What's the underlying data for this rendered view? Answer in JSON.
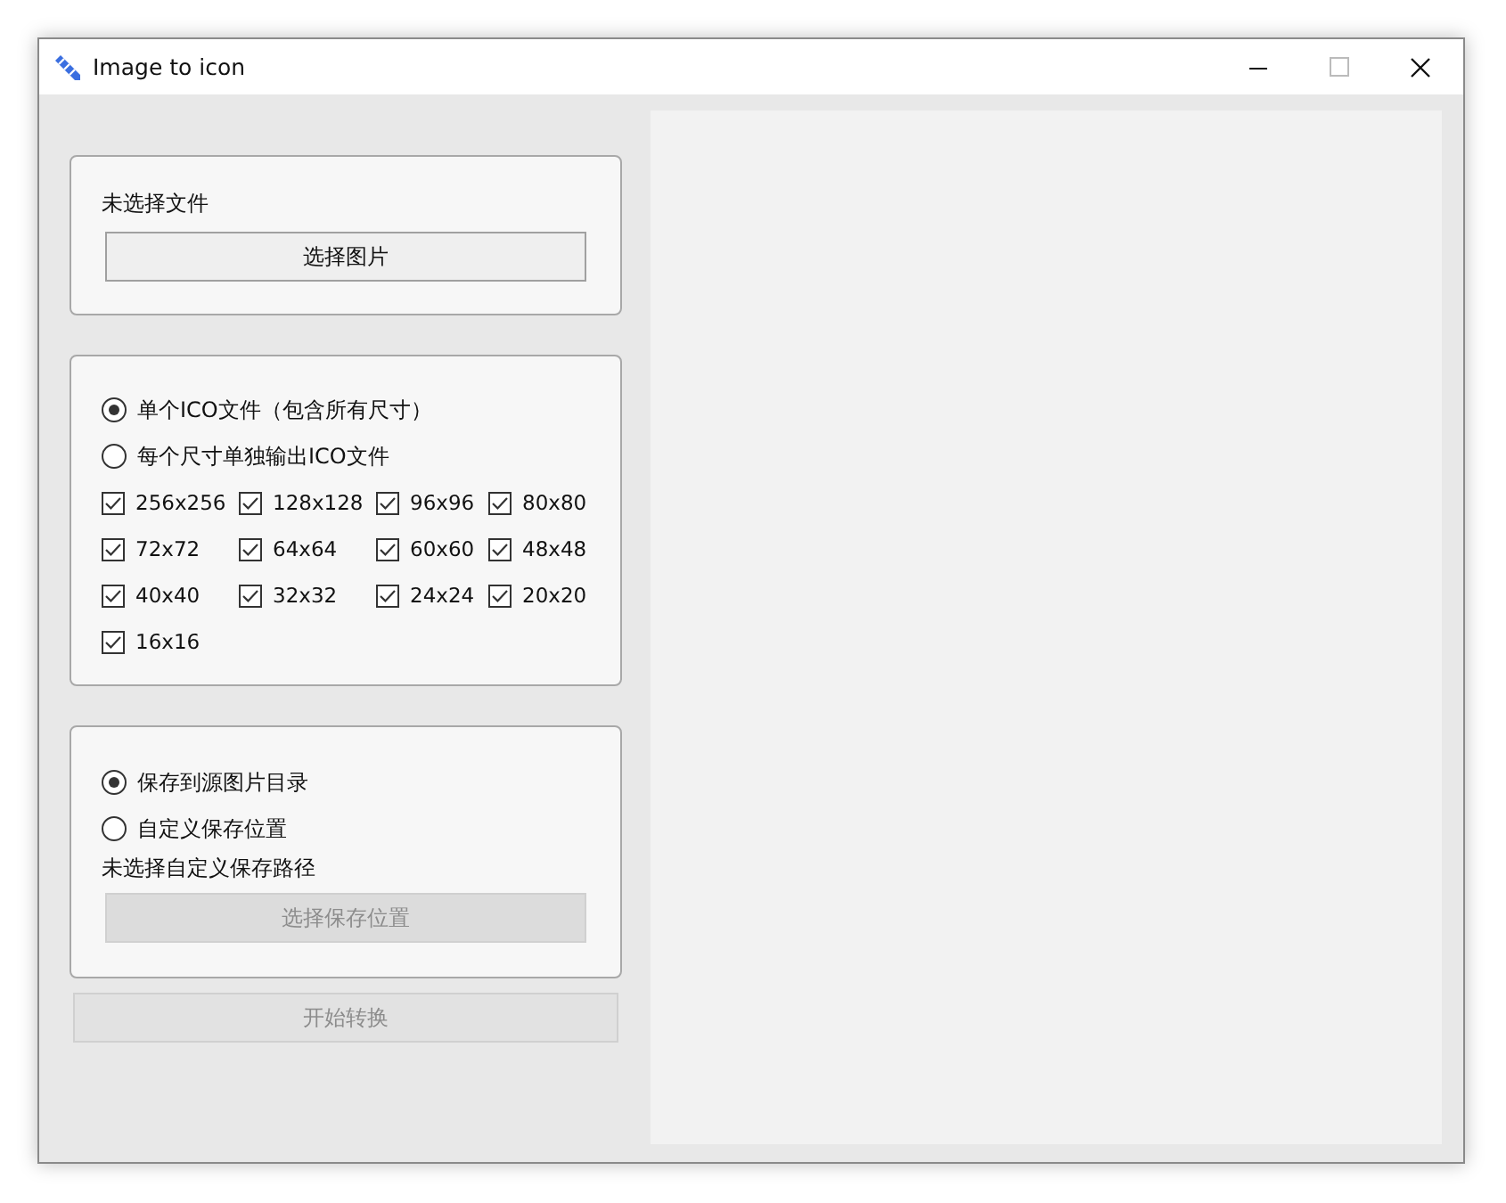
{
  "window": {
    "title": "Image to icon"
  },
  "file_group": {
    "status": "未选择文件",
    "button": {
      "label": "选择图片",
      "disabled": false
    }
  },
  "output_mode": [
    {
      "label": "单个ICO文件（包含所有尺寸）",
      "selected": true
    },
    {
      "label": "每个尺寸单独输出ICO文件",
      "selected": false
    }
  ],
  "sizes": [
    {
      "label": "256x256",
      "checked": true
    },
    {
      "label": "128x128",
      "checked": true
    },
    {
      "label": "96x96",
      "checked": true
    },
    {
      "label": "80x80",
      "checked": true
    },
    {
      "label": "72x72",
      "checked": true
    },
    {
      "label": "64x64",
      "checked": true
    },
    {
      "label": "60x60",
      "checked": true
    },
    {
      "label": "48x48",
      "checked": true
    },
    {
      "label": "40x40",
      "checked": true
    },
    {
      "label": "32x32",
      "checked": true
    },
    {
      "label": "24x24",
      "checked": true
    },
    {
      "label": "20x20",
      "checked": true
    },
    {
      "label": "16x16",
      "checked": true
    }
  ],
  "save_location": [
    {
      "label": "保存到源图片目录",
      "selected": true
    },
    {
      "label": "自定义保存位置",
      "selected": false
    }
  ],
  "save_path_status": "未选择自定义保存路径",
  "choose_location_button": {
    "label": "选择保存位置",
    "disabled": true
  },
  "start_button": {
    "label": "开始转换",
    "disabled": true
  }
}
